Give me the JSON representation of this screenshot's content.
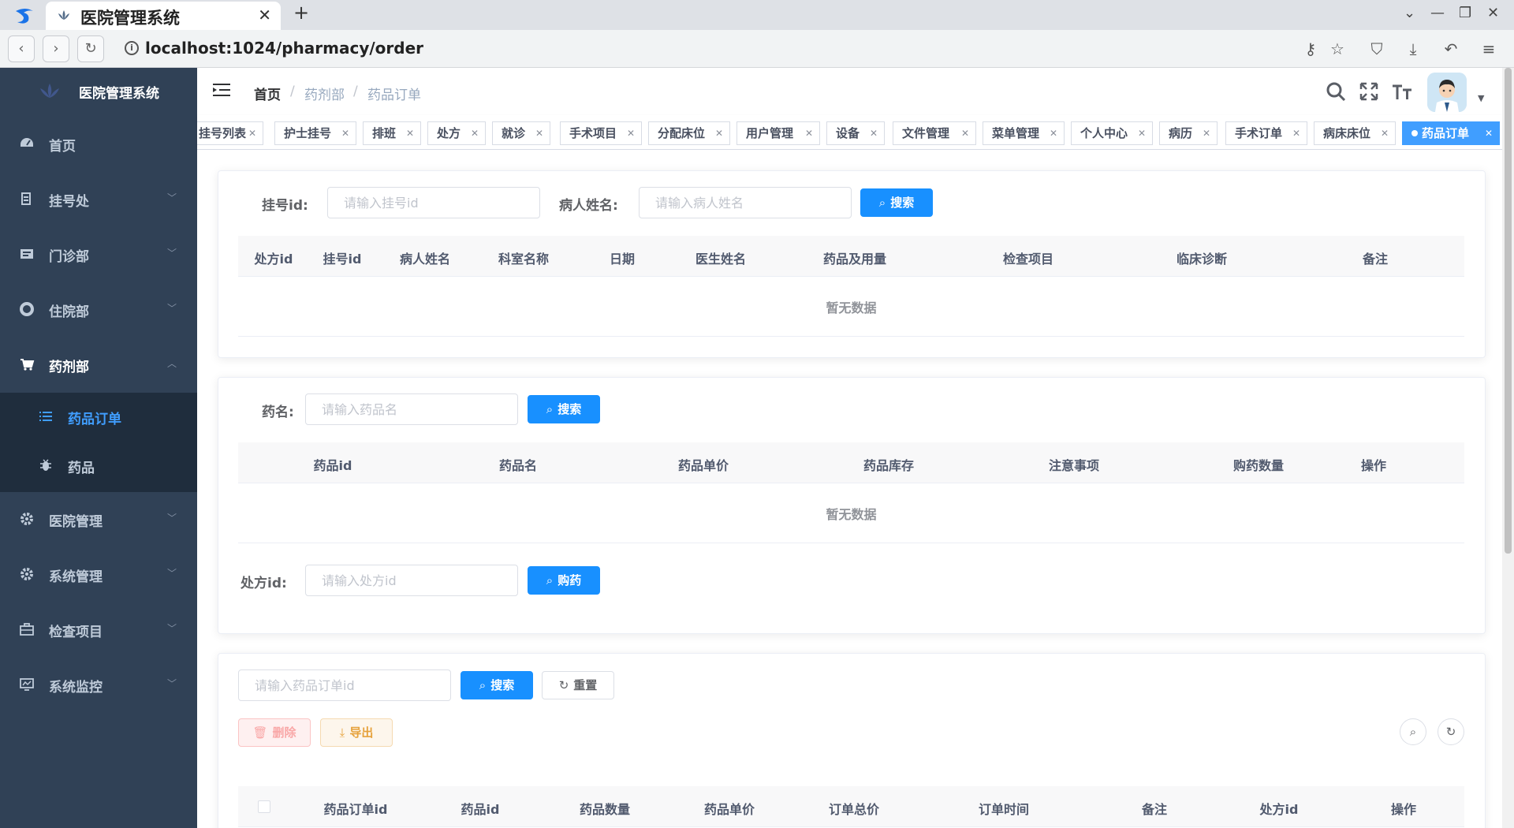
{
  "browser": {
    "tab_title": "医院管理系统",
    "url": "localhost:1024/pharmacy/order"
  },
  "sidebar": {
    "brand": "医院管理系统",
    "items": [
      {
        "label": "首页",
        "icon": "dashboard-icon"
      },
      {
        "label": "挂号处",
        "icon": "form-icon"
      },
      {
        "label": "门诊部",
        "icon": "message-icon"
      },
      {
        "label": "住院部",
        "icon": "lifebuoy-icon"
      },
      {
        "label": "药剂部",
        "icon": "cart-icon"
      },
      {
        "label": "医院管理",
        "icon": "gear-icon"
      },
      {
        "label": "系统管理",
        "icon": "gear-icon"
      },
      {
        "label": "检查项目",
        "icon": "briefcase-icon"
      },
      {
        "label": "系统监控",
        "icon": "monitor-icon"
      }
    ],
    "subitems": [
      {
        "label": "药品订单",
        "icon": "list-icon"
      },
      {
        "label": "药品",
        "icon": "bug-icon"
      }
    ]
  },
  "navbar": {
    "breadcrumb": [
      "首页",
      "药剂部",
      "药品订单"
    ]
  },
  "tags": [
    "挂号列表",
    "护士挂号",
    "排班",
    "处方",
    "就诊",
    "手术项目",
    "分配床位",
    "用户管理",
    "设备",
    "文件管理",
    "菜单管理",
    "个人中心",
    "病历",
    "手术订单",
    "病床床位",
    "药品订单"
  ],
  "card1": {
    "label_reg": "挂号id:",
    "ph_reg": "请输入挂号id",
    "label_patient": "病人姓名:",
    "ph_patient": "请输入病人姓名",
    "search": "搜索",
    "columns": [
      "处方id",
      "挂号id",
      "病人姓名",
      "科室名称",
      "日期",
      "医生姓名",
      "药品及用量",
      "检查项目",
      "临床诊断",
      "备注"
    ],
    "empty": "暂无数据"
  },
  "card2": {
    "label_drug": "药名:",
    "ph_drug": "请输入药品名",
    "search": "搜索",
    "columns": [
      "药品id",
      "药品名",
      "药品单价",
      "药品库存",
      "注意事项",
      "购药数量",
      "操作"
    ],
    "empty": "暂无数据",
    "label_rx": "处方id:",
    "ph_rx": "请输入处方id",
    "buy": "购药"
  },
  "card3": {
    "ph_order": "请输入药品订单id",
    "search": "搜索",
    "reset": "重置",
    "delete": "删除",
    "export": "导出",
    "columns": [
      "药品订单id",
      "药品id",
      "药品数量",
      "药品单价",
      "订单总价",
      "订单时间",
      "备注",
      "处方id",
      "操作"
    ]
  },
  "colors": {
    "sidebar_bg": "#304156",
    "submenu_bg": "#1f2d3d",
    "accent": "#409eff",
    "primary_button": "#1890ff"
  }
}
